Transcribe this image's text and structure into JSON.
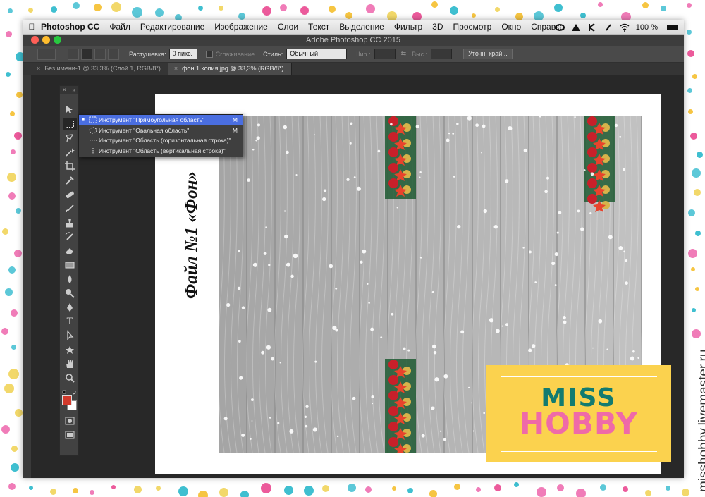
{
  "menubar": {
    "app": "Photoshop CC",
    "items": [
      "Файл",
      "Редактирование",
      "Изображение",
      "Слои",
      "Текст",
      "Выделение",
      "Фильтр",
      "3D",
      "Просмотр",
      "Окно",
      "Справка"
    ],
    "battery": "100 %"
  },
  "window": {
    "title": "Adobe Photoshop CC 2015"
  },
  "options": {
    "feather_label": "Растушевка:",
    "feather_value": "0 пикс.",
    "antialias_label": "Сглаживание",
    "style_label": "Стиль:",
    "style_value": "Обычный",
    "width_label": "Шир.:",
    "height_label": "Выс.:",
    "refine_button": "Уточн. край..."
  },
  "tabs": [
    {
      "label": "Без имени-1 @ 33,3% (Слой 1, RGB/8*)",
      "active": false
    },
    {
      "label": "фон 1 копия.jpg @ 33,3% (RGB/8*)",
      "active": true
    }
  ],
  "dropdown": {
    "items": [
      {
        "label": "Инструмент \"Прямоугольная область\"",
        "shortcut": "M",
        "selected": true,
        "icon": "rect-marquee-icon"
      },
      {
        "label": "Инструмент \"Овальная область\"",
        "shortcut": "M",
        "selected": false,
        "icon": "ellipse-marquee-icon"
      },
      {
        "label": "Инструмент \"Область (горизонтальная строка)\"",
        "shortcut": "",
        "selected": false,
        "icon": "row-marquee-icon"
      },
      {
        "label": "Инструмент \"Область (вертикальная строка)\"",
        "shortcut": "",
        "selected": false,
        "icon": "column-marquee-icon"
      }
    ]
  },
  "document": {
    "caption": "Файл №1 «Фон»"
  },
  "badge": {
    "line1": "MISS",
    "line2": "HOBBY"
  },
  "watermark": "misshobby.livemaster.ru",
  "colors": {
    "foreground": "#d23a2c",
    "background": "#ffffff",
    "badge_bg": "#fbd24e",
    "miss_text": "#127b70",
    "hobby_text": "#ef6aa8",
    "menu_highlight": "#4a6ee0"
  }
}
